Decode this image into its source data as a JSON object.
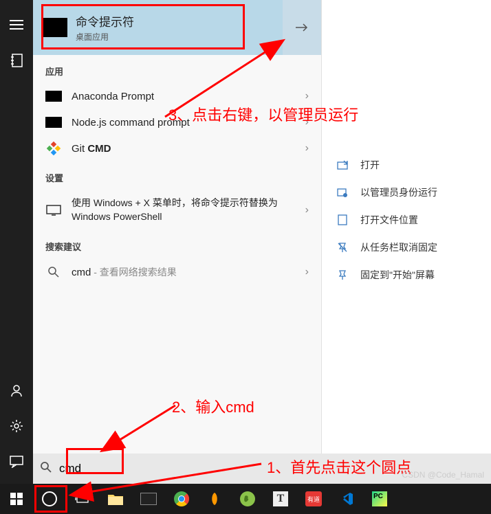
{
  "topResult": {
    "title": "命令提示符",
    "subtitle": "桌面应用"
  },
  "sections": {
    "apps": "应用",
    "settings": "设置",
    "suggestions": "搜索建议"
  },
  "appResults": [
    {
      "label": "Anaconda Prompt",
      "icon": "black"
    },
    {
      "label": "Node.js command prompt",
      "icon": "black"
    },
    {
      "label": "Git ",
      "bold": "CMD",
      "icon": "git"
    }
  ],
  "settingsResults": [
    {
      "label": "使用 Windows + X 菜单时，将命令提示符替换为 Windows PowerShell"
    }
  ],
  "suggestionResults": [
    {
      "prefix": "cmd",
      "suffix": " - 查看网络搜索结果"
    }
  ],
  "contextMenu": [
    {
      "label": "打开",
      "icon": "open"
    },
    {
      "label": "以管理员身份运行",
      "icon": "admin"
    },
    {
      "label": "打开文件位置",
      "icon": "folder"
    },
    {
      "label": "从任务栏取消固定",
      "icon": "unpin"
    },
    {
      "label": "固定到\"开始\"屏幕",
      "icon": "pin"
    }
  ],
  "searchInput": "cmd",
  "annotations": {
    "a1": "1、首先点击这个圆点",
    "a2": "2、输入cmd",
    "a3": "3、点击右键，以管理员运行"
  },
  "watermark": "CSDN @Code_Hamal"
}
